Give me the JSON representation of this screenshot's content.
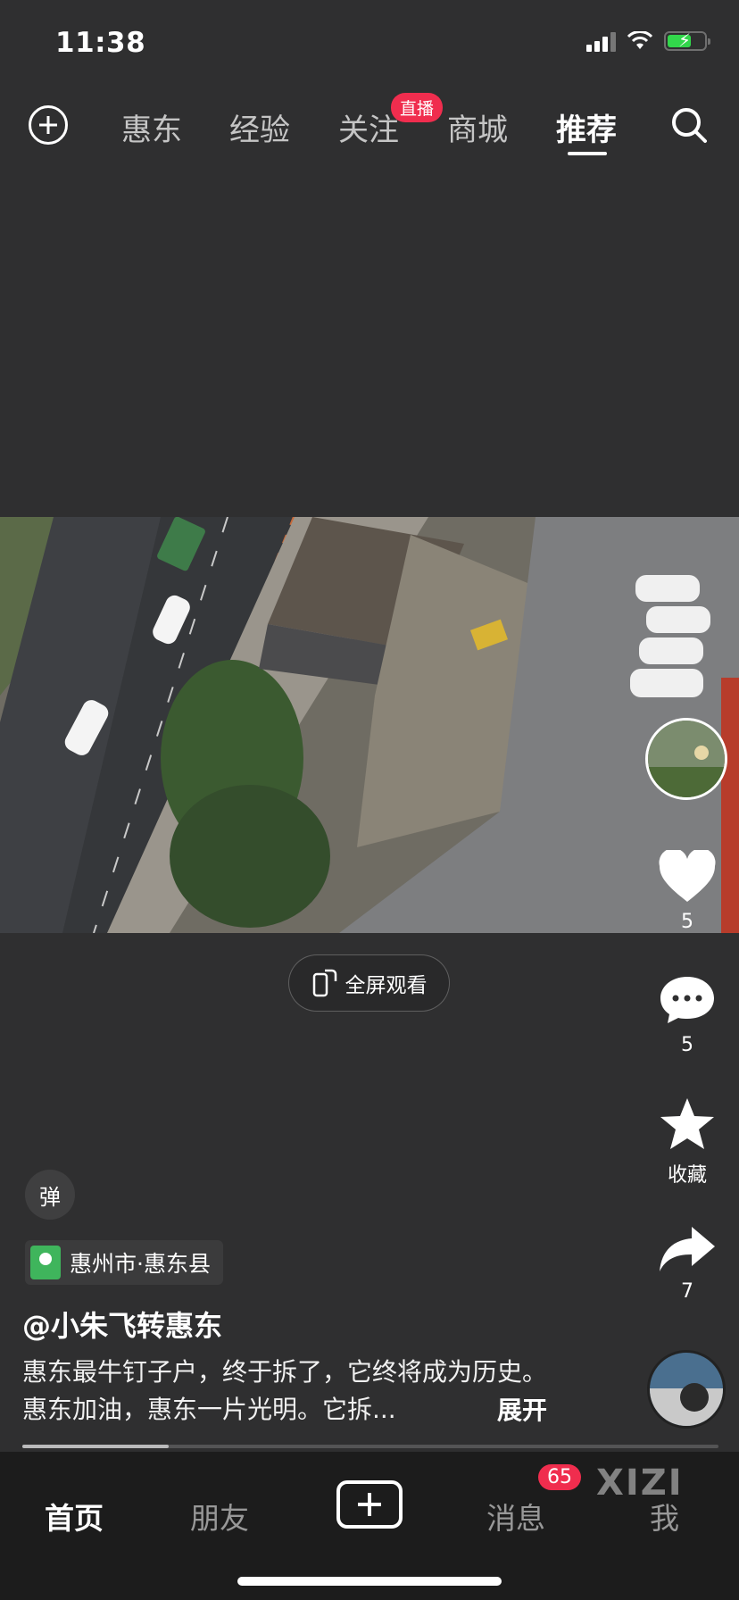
{
  "status_bar": {
    "time": "11:38"
  },
  "top_nav": {
    "tabs": [
      {
        "label": "惠东",
        "active": false
      },
      {
        "label": "经验",
        "active": false
      },
      {
        "label": "关注",
        "active": false
      },
      {
        "label": "商城",
        "active": false
      },
      {
        "label": "推荐",
        "active": true
      }
    ],
    "live_badge": "直播"
  },
  "video": {
    "fullscreen_label": "全屏观看"
  },
  "right_rail": {
    "like_count": "5",
    "comment_count": "5",
    "favorite_label": "收藏",
    "share_count": "7"
  },
  "info": {
    "danmu_label": "弹",
    "location": "惠州市·惠东县",
    "author": "@小朱飞转惠东",
    "description": "惠东最牛钉子户，终于拆了，它终将成为历史。惠东加油，惠东一片光明。它拆...",
    "expand_label": "展开",
    "progress": 0.21
  },
  "tab_bar": {
    "items": [
      {
        "label": "首页",
        "active": true
      },
      {
        "label": "朋友",
        "active": false
      },
      {
        "label": "消息",
        "active": false
      },
      {
        "label": "我",
        "active": false
      }
    ],
    "message_badge": "65"
  },
  "watermark": "XIZI",
  "colors": {
    "background": "#2f2f30",
    "accent": "#f02d4e",
    "tabbar": "#1c1c1c"
  }
}
